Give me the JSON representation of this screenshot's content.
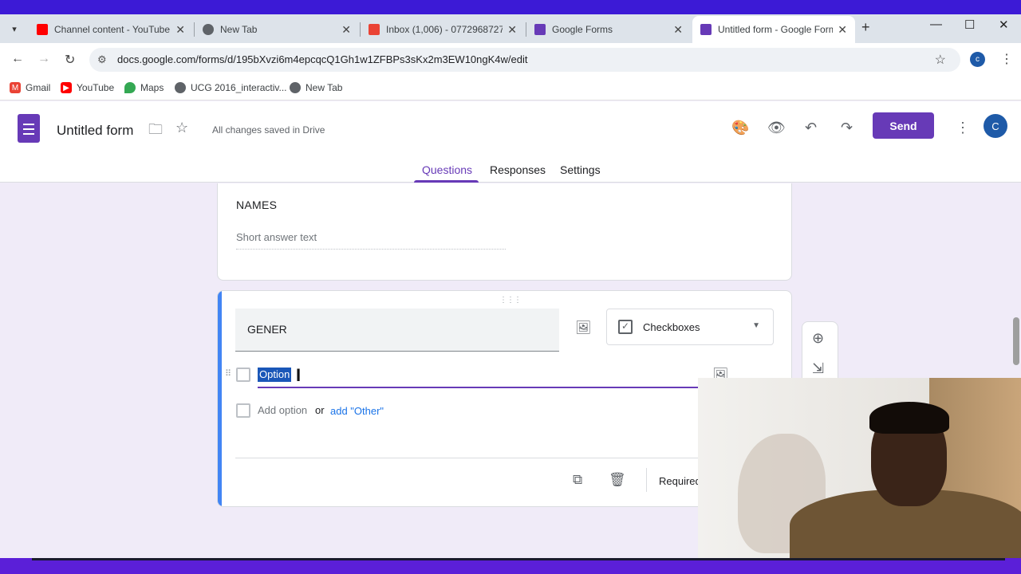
{
  "browser": {
    "tabs": [
      {
        "title": "Channel content - YouTube",
        "favicon": "youtube-icon",
        "color": "#ff0000"
      },
      {
        "title": "New Tab",
        "favicon": "chrome-icon",
        "color": "#5f6368"
      },
      {
        "title": "Inbox (1,006) - 0772968727",
        "favicon": "gmail-icon",
        "color": "#ea4335"
      },
      {
        "title": "Google Forms",
        "favicon": "forms-icon",
        "color": "#673ab7"
      },
      {
        "title": "Untitled form - Google Forms",
        "favicon": "forms-icon",
        "color": "#673ab7",
        "active": true
      }
    ],
    "url": "docs.google.com/forms/d/195bXvzi6m4epcqcQ1Gh1w1ZFBPs3sKx2m3EW10ngK4w/edit",
    "profile_initial": "c",
    "bookmarks": [
      {
        "label": "Gmail",
        "icon": "gmail-icon"
      },
      {
        "label": "YouTube",
        "icon": "youtube-icon"
      },
      {
        "label": "Maps",
        "icon": "maps-icon"
      },
      {
        "label": "UCG 2016_interactiv...",
        "icon": "globe-icon"
      },
      {
        "label": "New Tab",
        "icon": "globe-icon"
      }
    ]
  },
  "header": {
    "title": "Untitled form",
    "save_status": "All changes saved in Drive",
    "send_label": "Send",
    "avatar_initial": "C",
    "tabs": [
      "Questions",
      "Responses",
      "Settings"
    ],
    "active_tab": "Questions",
    "accent": "#673ab7"
  },
  "questions": [
    {
      "title": "NAMES",
      "placeholder": "Short answer text"
    },
    {
      "title": "GENER",
      "type": "Checkboxes",
      "options": [
        "Option"
      ],
      "add_option": "Add option",
      "or_text": "or",
      "add_other": "add \"Other\"",
      "required_label": "Required"
    }
  ]
}
